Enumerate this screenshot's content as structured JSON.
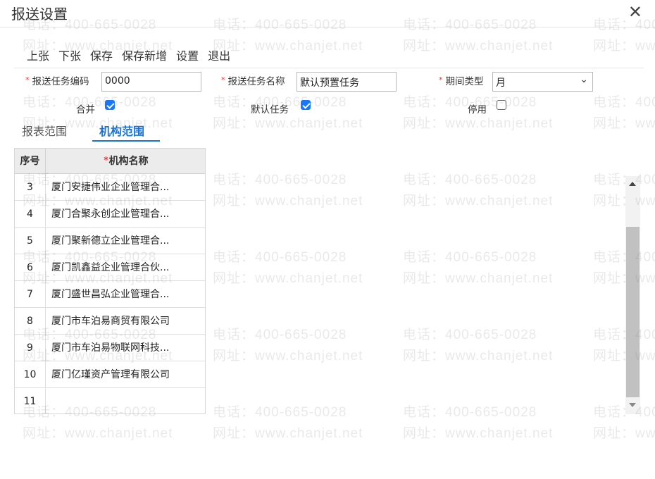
{
  "dialog": {
    "title": "报送设置",
    "close_glyph": "✕"
  },
  "toolbar": [
    "上张",
    "下张",
    "保存",
    "保存新增",
    "设置",
    "退出"
  ],
  "form": {
    "required_mark": "*",
    "task_code_label": "报送任务编码",
    "task_code_value": "0000",
    "task_name_label": "报送任务名称",
    "task_name_value": "默认预置任务",
    "period_type_label": "期间类型",
    "period_type_value": "月",
    "merge_label": "合并",
    "merge_checked": true,
    "default_task_label": "默认任务",
    "default_task_checked": true,
    "disabled_label": "停用",
    "disabled_checked": false
  },
  "tabs": [
    {
      "label": "报表范围",
      "active": false
    },
    {
      "label": "机构范围",
      "active": true
    }
  ],
  "grid": {
    "col_seq": "序号",
    "col_org": "机构名称",
    "rows": [
      {
        "seq": "3",
        "name": "厦门安捷伟业企业管理合..."
      },
      {
        "seq": "4",
        "name": "厦门合聚永创企业管理合..."
      },
      {
        "seq": "5",
        "name": "厦门聚新德立企业管理合..."
      },
      {
        "seq": "6",
        "name": "厦门凯鑫益企业管理合伙..."
      },
      {
        "seq": "7",
        "name": "厦门盛世昌弘企业管理合..."
      },
      {
        "seq": "8",
        "name": "厦门市车泊易商贸有限公司"
      },
      {
        "seq": "9",
        "name": "厦门市车泊易物联网科技..."
      },
      {
        "seq": "10",
        "name": "厦门亿瑾资产管理有限公司"
      },
      {
        "seq": "11",
        "name": ""
      }
    ]
  },
  "watermark": {
    "phone": "电话：400-665-0028",
    "site": "网址：www.chanjet.net"
  },
  "colors": {
    "accent": "#1a73d6",
    "checkbox": "#1677ff",
    "required": "#e4393c"
  }
}
